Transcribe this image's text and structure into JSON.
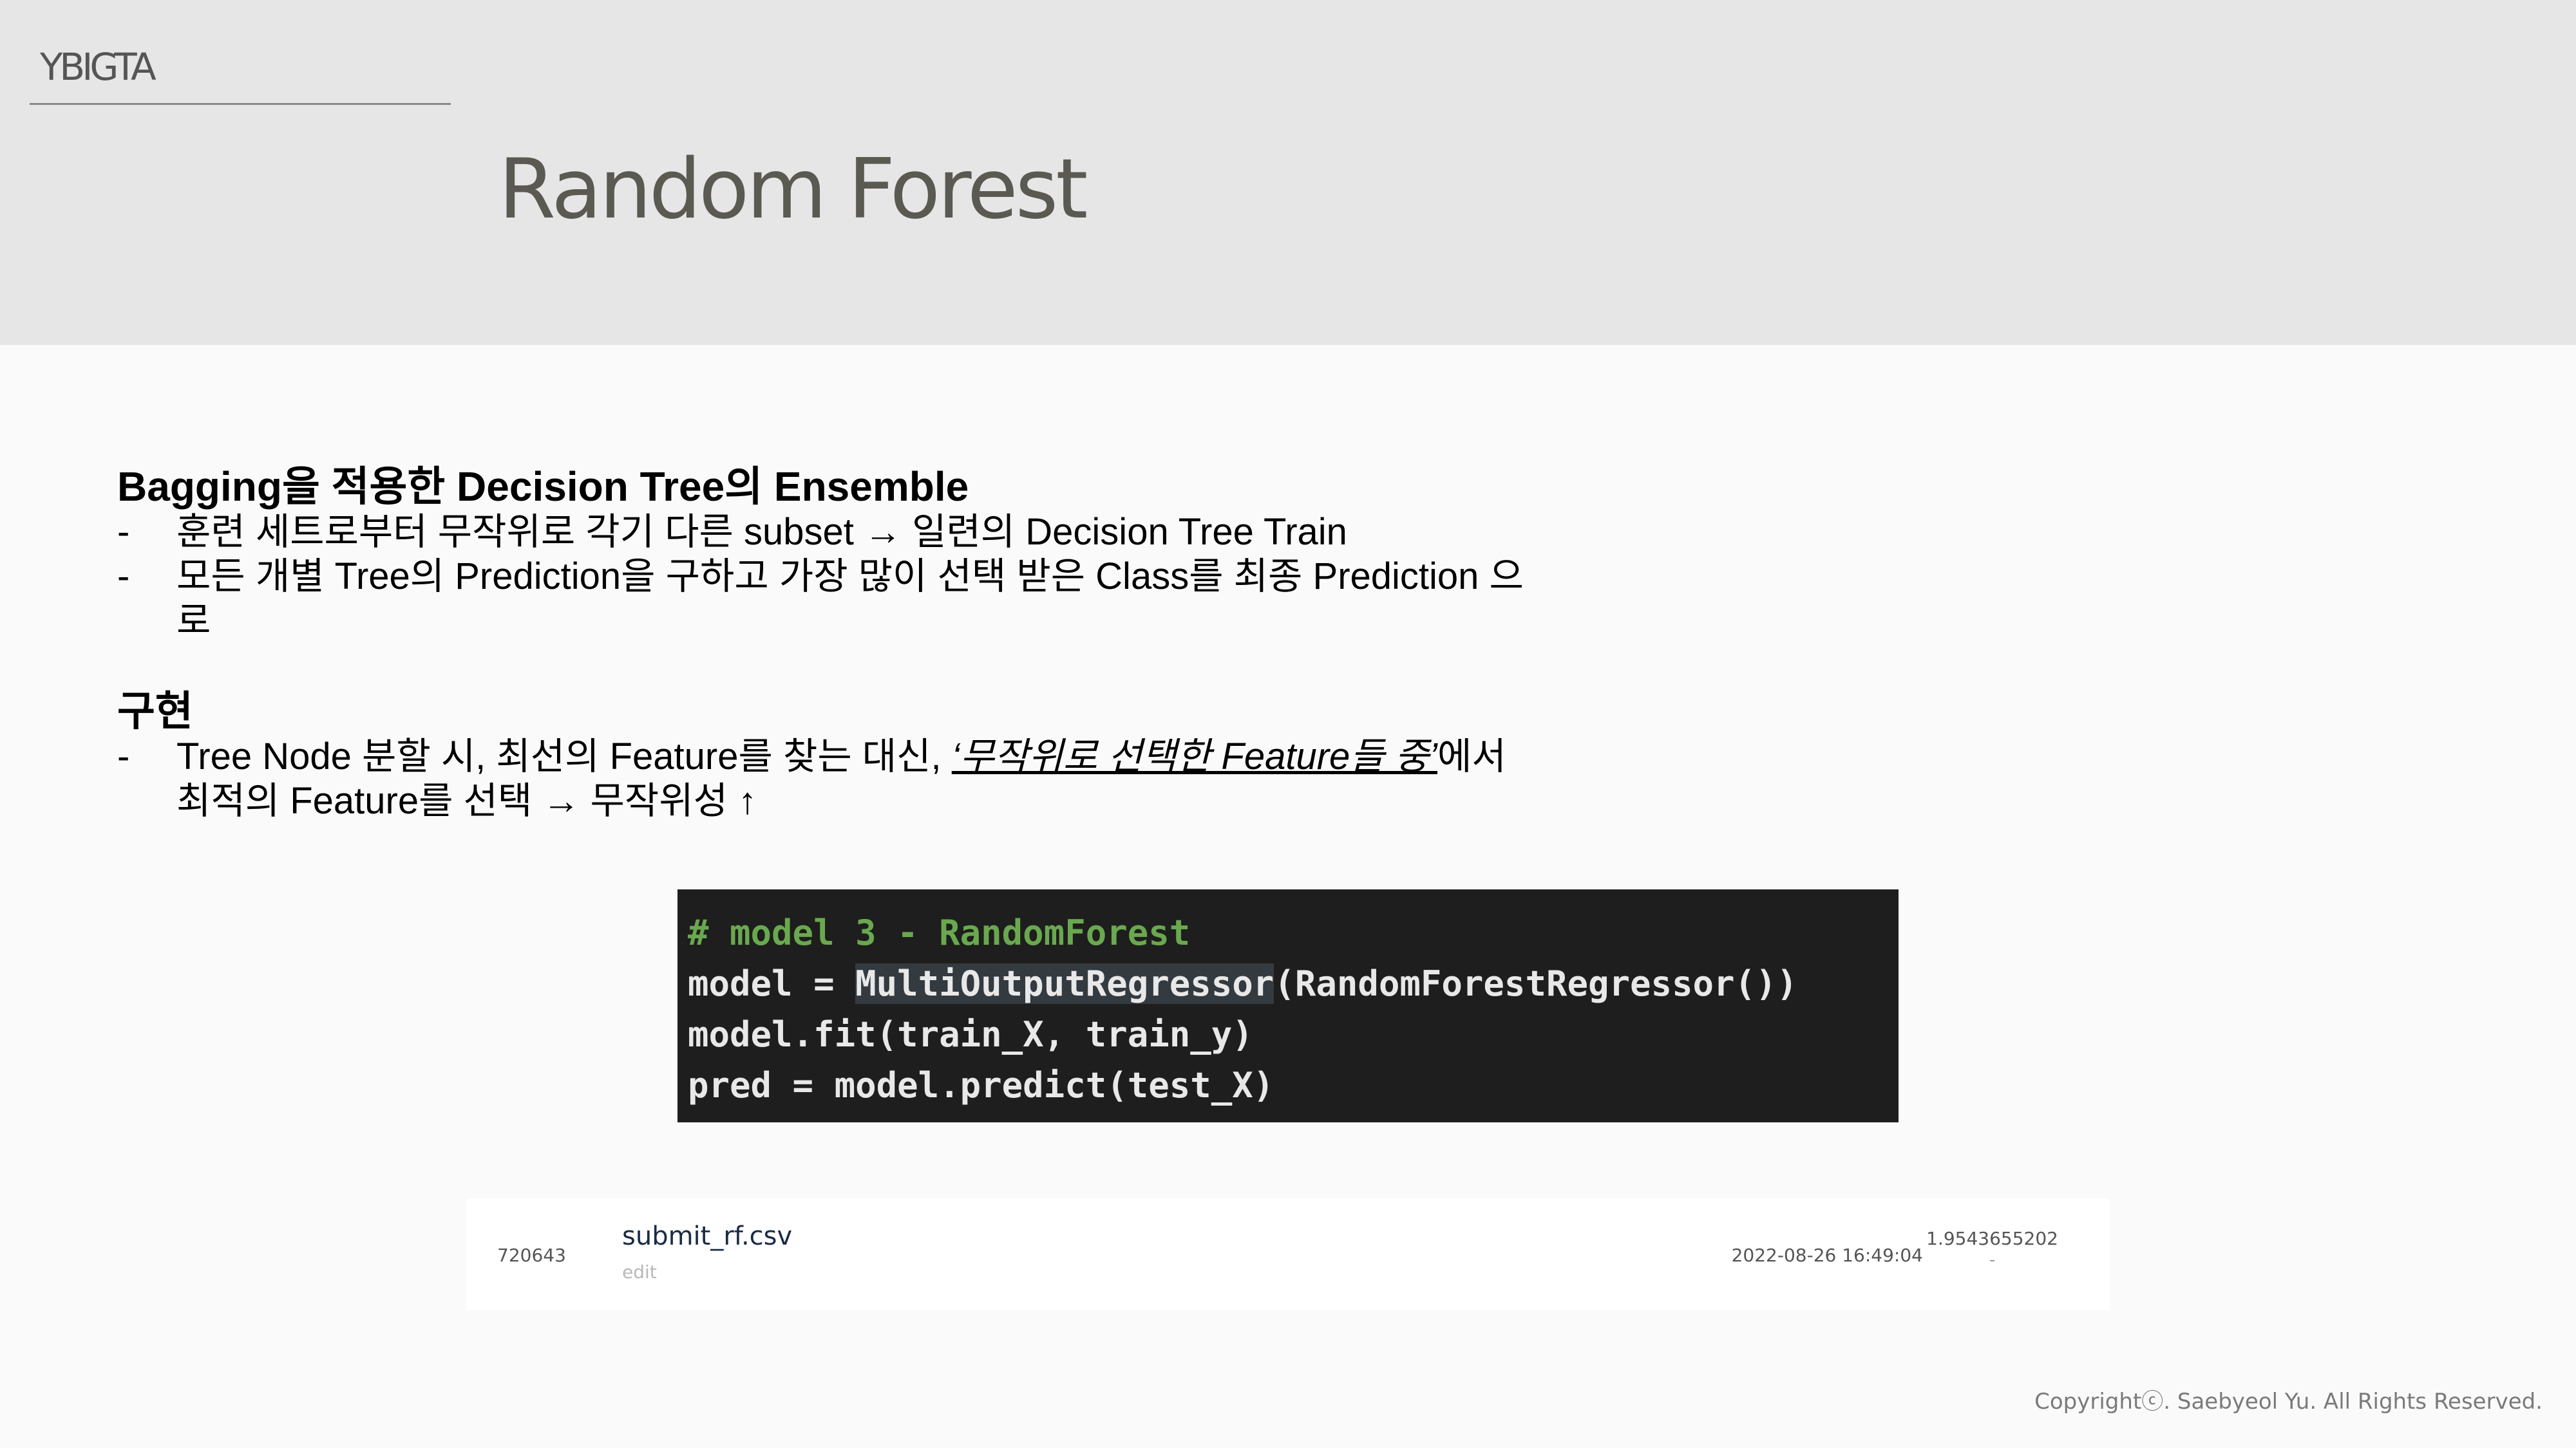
{
  "header": {
    "brand": "YBIGTA",
    "title": "Random Forest"
  },
  "sections": [
    {
      "heading": "Bagging을 적용한 Decision Tree의 Ensemble",
      "bullets": [
        {
          "dash": "-",
          "text": "훈련 세트로부터 무작위로 각기 다른 subset → 일련의 Decision Tree Train"
        },
        {
          "dash": "-",
          "text": "모든 개별 Tree의 Prediction을 구하고 가장 많이 선택 받은 Class를 최종 Prediction 으로"
        }
      ]
    },
    {
      "heading": "구현",
      "bullets": [
        {
          "dash": "-",
          "before": "Tree Node 분할 시, 최선의 Feature를 찾는 대신, ",
          "emphasis": "‘무작위로 선택한 Feature들 중’",
          "after": "에서 최적의 Feature를 선택 → 무작위성 ↑"
        }
      ]
    }
  ],
  "code": {
    "comment": "# model 3 - RandomForest",
    "line2_prefix": "model = ",
    "line2_highlight": "MultiOutputRegressor",
    "line2_suffix": "(RandomForestRegressor())",
    "line3": "model.fit(train_X, train_y)",
    "line4": "pred = model.predict(test_X)"
  },
  "submission": {
    "id": "720643",
    "filename": "submit_rf.csv",
    "edit_label": "edit",
    "timestamp": "2022-08-26 16:49:04",
    "score": "1.9543655202",
    "score_sub": "-"
  },
  "footer": {
    "copyright": "Copyrightⓒ. Saebyeol Yu. All Rights Reserved."
  },
  "colors": {
    "header_bg": "#e6e6e6",
    "page_bg": "#fafafa",
    "code_bg": "#1e1e1e",
    "code_comment": "#6aa84f",
    "title": "#5a5a52"
  }
}
